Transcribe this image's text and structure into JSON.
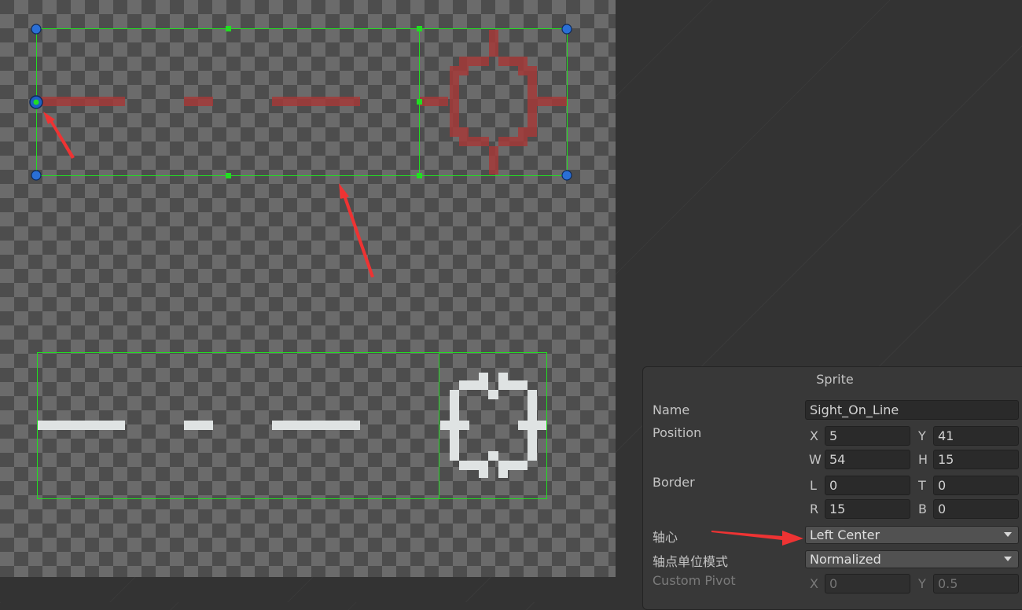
{
  "inspector": {
    "title": "Sprite",
    "name_label": "Name",
    "name_value": "Sight_On_Line",
    "position_label": "Position",
    "position": {
      "x_label": "X",
      "x": "5",
      "y_label": "Y",
      "y": "41",
      "w_label": "W",
      "w": "54",
      "h_label": "H",
      "h": "15"
    },
    "border_label": "Border",
    "border": {
      "l_label": "L",
      "l": "0",
      "t_label": "T",
      "t": "0",
      "r_label": "R",
      "r": "15",
      "b_label": "B",
      "b": "0"
    },
    "pivot_label": "轴心",
    "pivot_value": "Left Center",
    "pivot_unit_label": "轴点单位模式",
    "pivot_unit_value": "Normalized",
    "custom_pivot_label": "Custom Pivot",
    "custom_pivot": {
      "x_label": "X",
      "x": "0",
      "y_label": "Y",
      "y": "0.5"
    }
  },
  "colors": {
    "selection_green": "#22dd22",
    "handle_blue": "#2a6fd6",
    "sprite_red": "#a33a38",
    "sprite_white": "#dfe3e3",
    "annotation_red": "#ee3333"
  },
  "icons": [
    "pivot-handle-icon",
    "corner-handle-icon",
    "annotation-arrow-icon",
    "dropdown-caret-icon"
  ]
}
